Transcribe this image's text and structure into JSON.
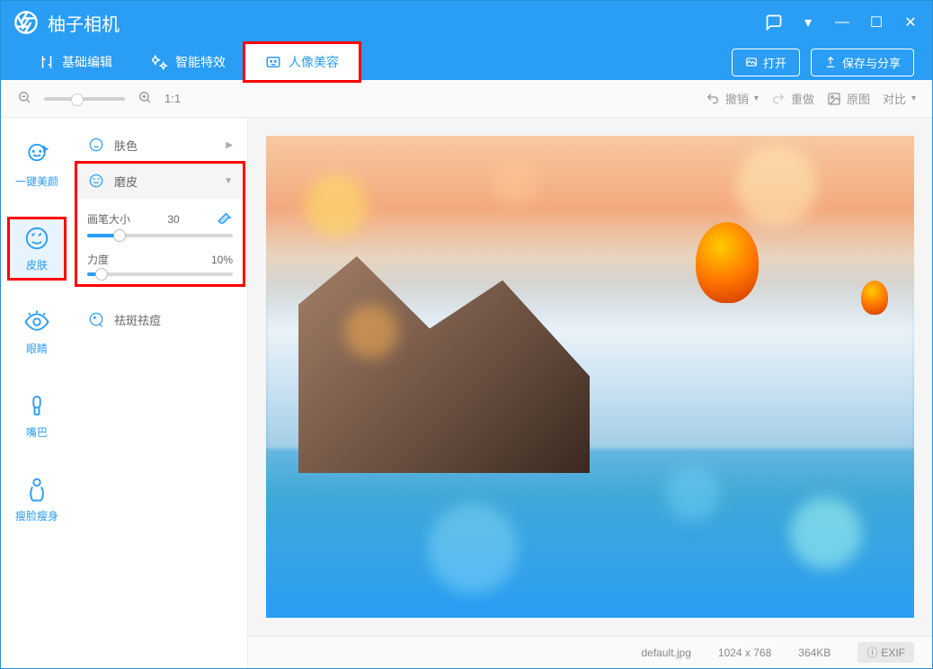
{
  "app": {
    "title": "柚子相机"
  },
  "tabs": {
    "basic": "基础编辑",
    "smart": "智能特效",
    "portrait": "人像美容"
  },
  "actions": {
    "open": "打开",
    "save": "保存与分享"
  },
  "toolbar": {
    "zoom_ratio": "1:1",
    "undo": "撤销",
    "redo": "重做",
    "original": "原图",
    "compare": "对比"
  },
  "sidebar": {
    "auto": "一键美颜",
    "skin": "皮肤",
    "eyes": "眼睛",
    "mouth": "嘴巴",
    "slim": "瘦脸瘦身"
  },
  "panel": {
    "skin_color": "肤色",
    "smooth": "磨皮",
    "brush_size_label": "画笔大小",
    "brush_size_value": "30",
    "strength_label": "力度",
    "strength_value": "10%",
    "blemish": "祛斑祛痘"
  },
  "status": {
    "filename": "default.jpg",
    "dimensions": "1024 x 768",
    "filesize": "364KB",
    "exif": "EXIF"
  }
}
